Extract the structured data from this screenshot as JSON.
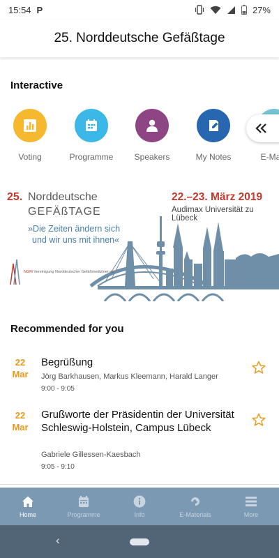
{
  "status_bar": {
    "time": "15:54",
    "app_icon": "P",
    "battery": "27%"
  },
  "header": {
    "title": "25. Norddeutsche Gefäßtage"
  },
  "interactive": {
    "title": "Interactive",
    "tiles": [
      {
        "label": "Voting",
        "icon": "bar-chart-icon",
        "color": "#f5b82e"
      },
      {
        "label": "Programme",
        "icon": "calendar-icon",
        "color": "#3bb8e8"
      },
      {
        "label": "Speakers",
        "icon": "person-icon",
        "color": "#8e4583"
      },
      {
        "label": "My Notes",
        "icon": "note-icon",
        "color": "#2966b0"
      },
      {
        "label": "E-Mate",
        "icon": "e-materials-icon",
        "color": "#74c4d4"
      }
    ]
  },
  "banner": {
    "number": "25.",
    "title_line1": "Norddeutsche",
    "title_line2": "GEFÄßTAGE",
    "motto_line1": "»Die Zeiten ändern sich",
    "motto_line2": "und wir uns mit ihnen«",
    "date": "22.–23. März 2019",
    "venue": "Audimax Universität zu Lübeck",
    "logo_abbr": "NGM",
    "logo_text": "Vereinigung Norddeutscher Gefäßmediziner eV."
  },
  "recommended": {
    "title": "Recommended for you",
    "items": [
      {
        "day": "22",
        "month": "Mar",
        "title": "Begrüßung",
        "speakers": "Jörg Barkhausen, Markus Kleemann, Harald Langer",
        "time": "9:00 - 9:05"
      },
      {
        "day": "22",
        "month": "Mar",
        "title": "Grußworte der Präsidentin der Universität Schleswig-Holstein, Campus Lübeck",
        "speakers": "Gabriele Gillessen-Kaesbach",
        "time": "9:05 - 9:10"
      }
    ]
  },
  "bottom_nav": {
    "items": [
      {
        "label": "Home",
        "icon": "home-icon",
        "active": true
      },
      {
        "label": "Programme",
        "icon": "calendar-icon",
        "active": false
      },
      {
        "label": "Info",
        "icon": "info-icon",
        "active": false
      },
      {
        "label": "E-Materials",
        "icon": "e-materials-icon",
        "active": false
      },
      {
        "label": "More",
        "icon": "menu-icon",
        "active": false
      }
    ]
  },
  "colors": {
    "accent_orange": "#e8981b",
    "nav_bg": "#7b99b3",
    "system_nav_bg": "#526577",
    "banner_red": "#c0392b",
    "banner_blue": "#4a7ea8"
  }
}
